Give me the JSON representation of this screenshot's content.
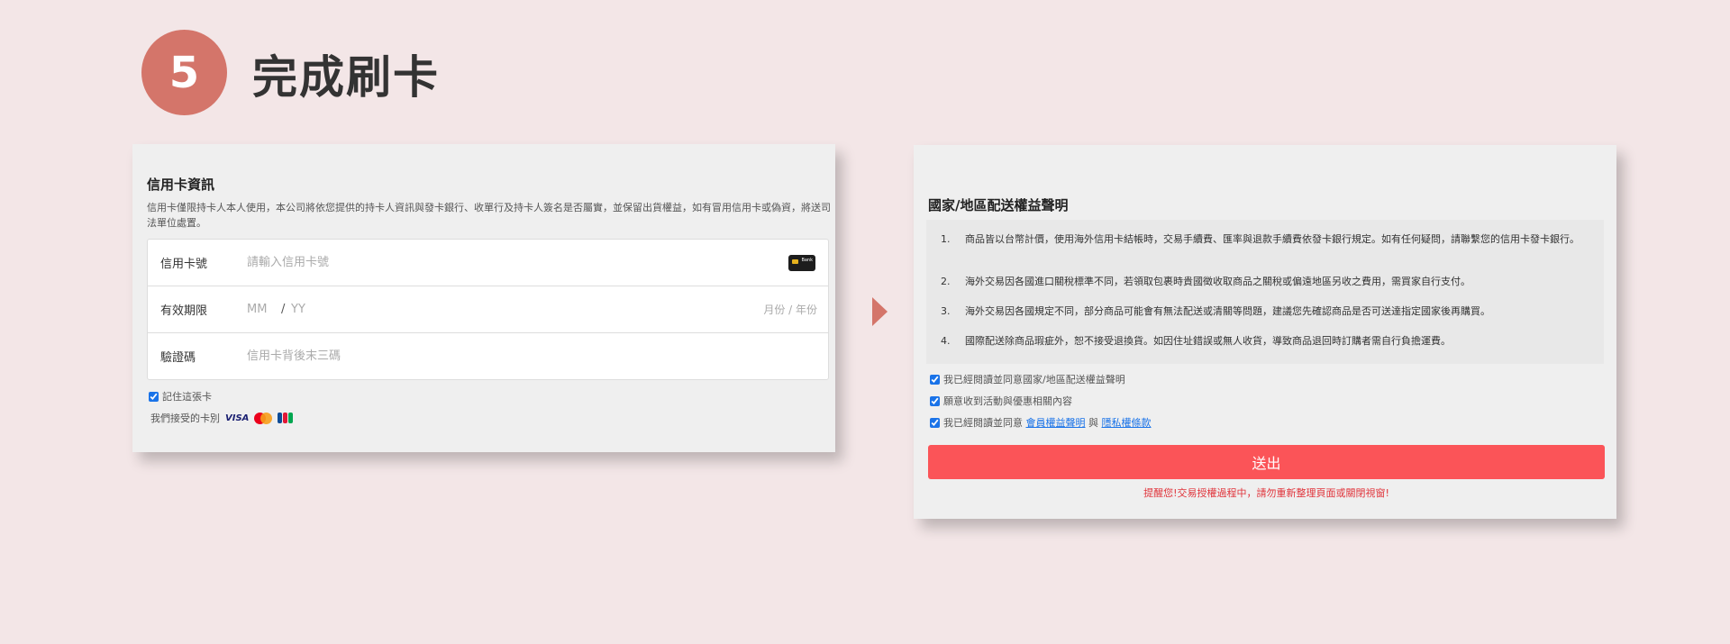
{
  "step": {
    "number": "5",
    "title": "完成刷卡"
  },
  "card": {
    "title": "信用卡資訊",
    "description": "信用卡僅限持卡人本人使用，本公司將依您提供的持卡人資訊與發卡銀行、收單行及持卡人簽名是否屬實，並保留出貨權益，如有冒用信用卡或偽資，將送司法單位處置。",
    "number_label": "信用卡號",
    "number_placeholder": "請輸入信用卡號",
    "bank_text": "Bank",
    "expiry_label": "有效期限",
    "expiry_mm_placeholder": "MM",
    "expiry_slash": "/",
    "expiry_yy_placeholder": "YY",
    "expiry_hint": "月份 / 年份",
    "cvc_label": "驗證碼",
    "cvc_placeholder": "信用卡背後末三碼",
    "remember_label": "記住這張卡",
    "accepted_label": "我們接受的卡別",
    "visa_text": "VISA"
  },
  "notice": {
    "title": "國家/地區配送權益聲明",
    "items": [
      {
        "num": "1.",
        "text": "商品皆以台幣計價，使用海外信用卡結帳時，交易手續費、匯率與退款手續費依發卡銀行規定。如有任何疑問，請聯繫您的信用卡發卡銀行。"
      },
      {
        "num": "2.",
        "text": "海外交易因各國進口關稅標準不同，若領取包裹時貴國徵收取商品之關稅或偏遠地區另收之費用，需買家自行支付。"
      },
      {
        "num": "3.",
        "text": "海外交易因各國規定不同，部分商品可能會有無法配送或清關等問題，建議您先確認商品是否可送達指定國家後再購買。"
      },
      {
        "num": "4.",
        "text": "國際配送除商品瑕疵外，恕不接受退換貨。如因住址錯誤或無人收貨，導致商品退回時訂購者需自行負擔運費。"
      }
    ],
    "agree_region": "我已經閱讀並同意國家/地區配送權益聲明",
    "agree_promo": "願意收到活動與優惠相關內容",
    "agree_terms_prefix": "我已經閱讀並同意",
    "agree_terms_link1": "會員權益聲明",
    "agree_terms_and": "與",
    "agree_terms_link2": "隱私權條款",
    "submit_label": "送出",
    "warning": "提醒您!交易授權過程中，請勿重新整理頁面或關閉視窗!"
  },
  "colors": {
    "accent": "#d4756a",
    "submit": "#fb5458",
    "warning": "#e0333a",
    "link": "#1a73e8"
  }
}
